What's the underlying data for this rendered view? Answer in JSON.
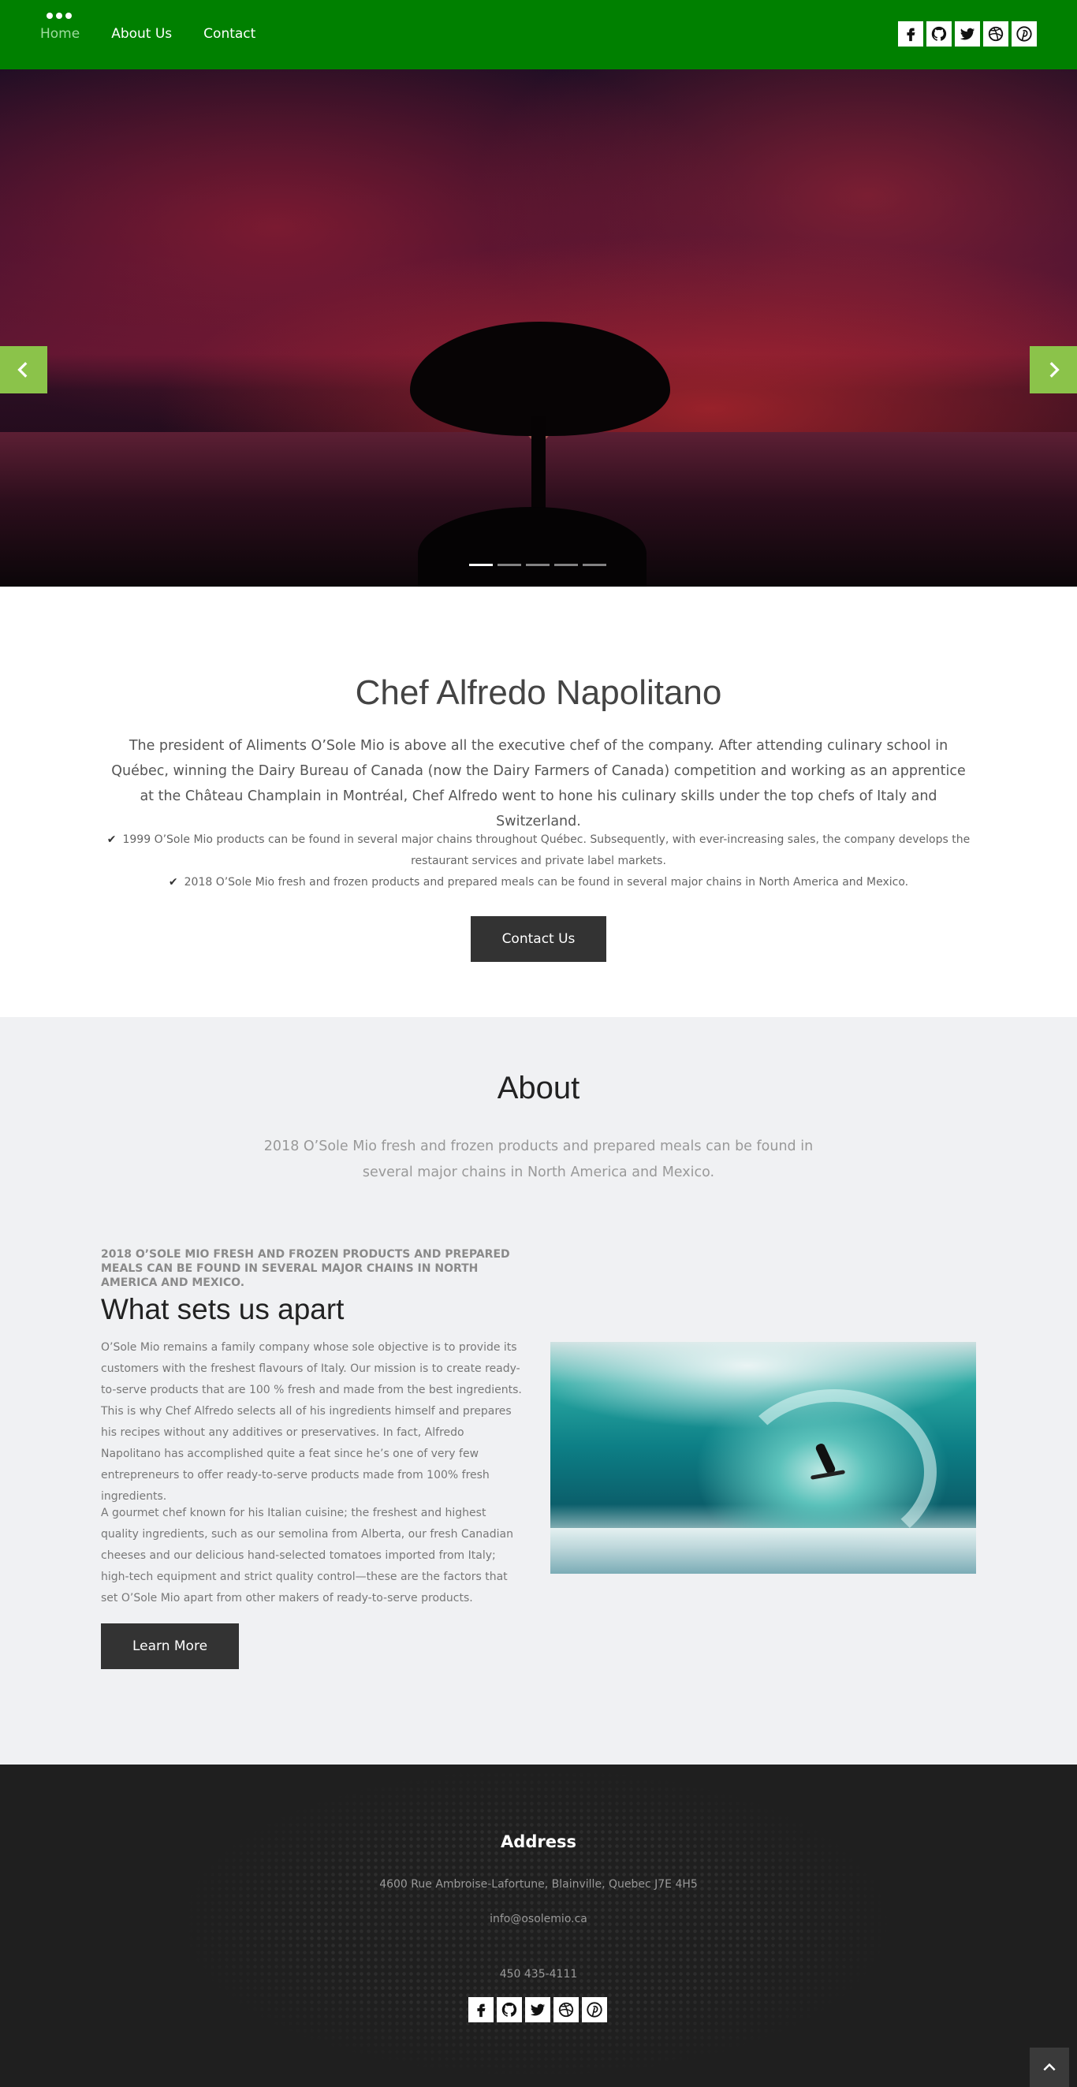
{
  "nav": {
    "links": [
      {
        "label": "Home",
        "active": true
      },
      {
        "label": "About Us",
        "active": false
      },
      {
        "label": "Contact",
        "active": false
      }
    ],
    "social_icons": [
      "facebook-icon",
      "github-icon",
      "twitter-icon",
      "dribbble-icon",
      "pinterest-icon"
    ],
    "background_color": "#008000"
  },
  "hero": {
    "slide_count": 5,
    "active_slide": 1,
    "arrow_color": "#8bc34a"
  },
  "chef": {
    "title": "Chef Alfredo Napolitano",
    "intro": "The president of Aliments O’Sole Mio is above all the executive chef of the company. After attending culinary school in Québec, winning the Dairy Bureau of Canada (now the Dairy Farmers of Canada) competition and working as an apprentice at the Château Champlain in Montréal, Chef Alfredo went to hone his culinary skills under the top chefs of Italy and Switzerland.",
    "milestones": [
      "1999 O’Sole Mio products can be found in several major chains throughout Québec. Subsequently, with ever-increasing sales, the company develops the restaurant services and private label markets.",
      "2018 O’Sole Mio fresh and frozen products and prepared meals can be found in several major chains in North America and Mexico."
    ],
    "contact_button": "Contact Us"
  },
  "about": {
    "title": "About",
    "lead": "2018 O’Sole Mio fresh and frozen products and prepared meals can be found in several major chains in North America and Mexico.",
    "kicker": "2018 O’Sole Mio fresh and frozen products and prepared meals can be found in several major chains in North America and Mexico.",
    "heading": "What sets us apart",
    "paragraph1": "O’Sole Mio remains a family company whose sole objective is to provide its customers with the freshest flavours of Italy. Our mission is to create ready-to-serve products that are 100 % fresh and made from the best ingredients. This is why Chef Alfredo selects all of his ingredients himself and prepares his recipes without any additives or preservatives. In fact, Alfredo Napolitano has accomplished quite a feat since he’s one of very few entrepreneurs to offer ready-to-serve products made from 100% fresh ingredients.",
    "paragraph2": "A gourmet chef known for his Italian cuisine; the freshest and highest quality ingredients, such as our semolina from Alberta, our fresh Canadian cheeses and our delicious hand-selected tomatoes imported from Italy; high-tech equipment and strict quality control—these are the factors that set O’Sole Mio apart from other makers of ready-to-serve products.",
    "learn_more_button": "Learn More"
  },
  "footer": {
    "heading": "Address",
    "address": "4600 Rue Ambroise-Lafortune, Blainville, Quebec J7E 4H5",
    "email": "info@osolemio.ca",
    "phone": "450 435-4111",
    "social_icons": [
      "facebook-icon",
      "github-icon",
      "twitter-icon",
      "dribbble-icon",
      "pinterest-icon"
    ],
    "scroll_top_icon": "chevron-up-icon"
  }
}
